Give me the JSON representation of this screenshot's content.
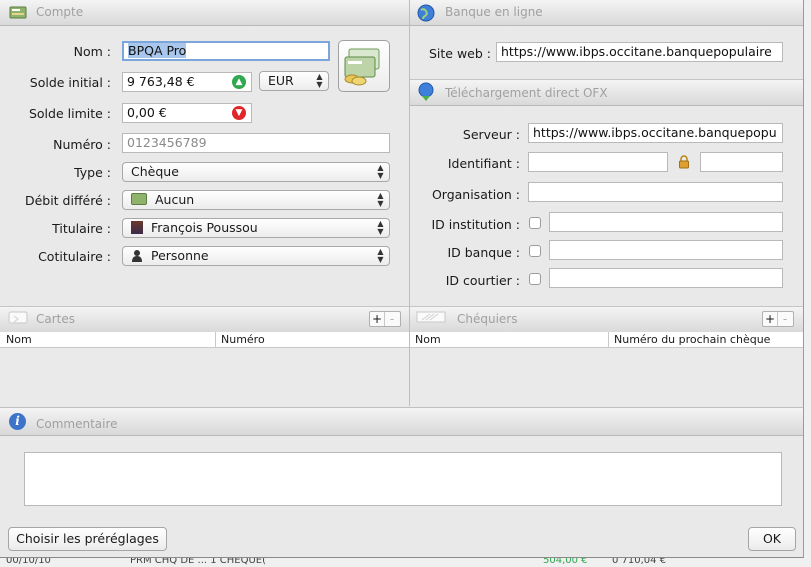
{
  "compte": {
    "title": "Compte",
    "nom_label": "Nom :",
    "nom_value": "BPQA Pro",
    "solde_initial_label": "Solde initial :",
    "solde_initial_value": "9 763,48 €",
    "currency": "EUR",
    "solde_limite_label": "Solde limite :",
    "solde_limite_value": "0,00 €",
    "numero_label": "Numéro :",
    "numero_placeholder": "0123456789",
    "type_label": "Type :",
    "type_value": "Chèque",
    "debit_label": "Débit différé :",
    "debit_value": "Aucun",
    "titulaire_label": "Titulaire :",
    "titulaire_value": "François Poussou",
    "cotitulaire_label": "Cotitulaire :",
    "cotitulaire_value": "Personne"
  },
  "banque": {
    "title": "Banque en ligne",
    "site_label": "Site web :",
    "site_value": "https://www.ibps.occitane.banquepopulaire"
  },
  "ofx": {
    "title": "Téléchargement direct OFX",
    "serveur_label": "Serveur :",
    "serveur_value": "https://www.ibps.occitane.banquepopu",
    "identifiant_label": "Identifiant :",
    "organisation_label": "Organisation :",
    "id_institution_label": "ID institution :",
    "id_banque_label": "ID banque :",
    "id_courtier_label": "ID courtier :"
  },
  "cartes": {
    "title": "Cartes",
    "columns": [
      "Nom",
      "Numéro"
    ]
  },
  "chequiers": {
    "title": "Chéquiers",
    "columns": [
      "Nom",
      "Numéro du prochain chèque"
    ]
  },
  "commentaire": {
    "title": "Commentaire"
  },
  "footer": {
    "presets_button": "Choisir les préréglages",
    "ok_button": "OK"
  },
  "background": {
    "row_date": "00/10/10",
    "row_text": "PRM CHQ  DE  ... 1 CHEQUE(",
    "row_amount": "504,00 €",
    "row_balance": "0 710,04 €"
  },
  "colors": {
    "accent_green": "#2fa84f",
    "accent_red": "#e0262b",
    "selection": "#a9c6ec"
  }
}
